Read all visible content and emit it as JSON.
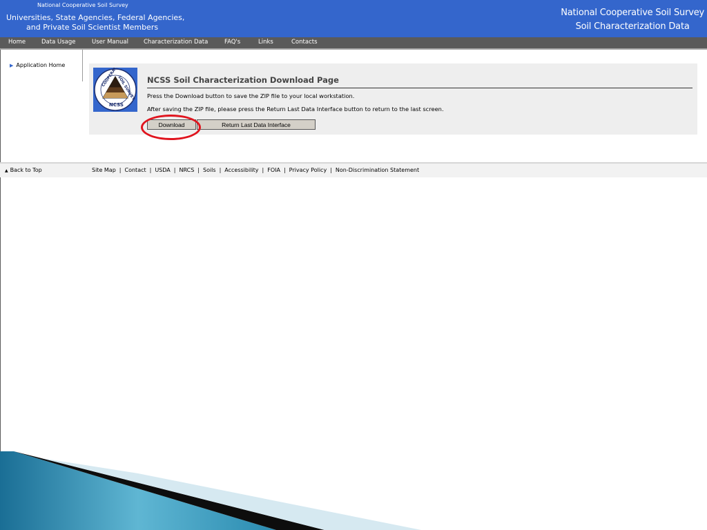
{
  "header": {
    "small_title": "National Cooperative Soil Survey",
    "left_line1": "Universities, State Agencies, Federal Agencies,",
    "left_line2": "and Private Soil Scientist Members",
    "right_line1": "National Cooperative Soil Survey",
    "right_line2": "Soil Characterization Data"
  },
  "nav": {
    "items": [
      {
        "label": "Home"
      },
      {
        "label": "Data Usage"
      },
      {
        "label": "User Manual"
      },
      {
        "label": "Characterization Data"
      },
      {
        "label": "FAQ's"
      },
      {
        "label": "Links"
      },
      {
        "label": "Contacts"
      }
    ]
  },
  "sidebar": {
    "items": [
      {
        "label": "Application Home"
      }
    ]
  },
  "logo": {
    "text_top": "COOPERATIVE",
    "text_right": "SOIL SURVEY",
    "text_bottom": "NCSS"
  },
  "main": {
    "title": "NCSS Soil Characterization Download Page",
    "line1": "Press the Download button to save the ZIP file to your local workstation.",
    "line2": "After saving the ZIP file, please press the Return Last Data Interface button to return to the last screen.",
    "download_label": "Download",
    "return_label": "Return Last Data Interface"
  },
  "footer": {
    "back_to_top": "Back to Top",
    "links": [
      {
        "label": "Site Map"
      },
      {
        "label": "Contact"
      },
      {
        "label": "USDA"
      },
      {
        "label": "NRCS"
      },
      {
        "label": "Soils"
      },
      {
        "label": "Accessibility"
      },
      {
        "label": "FOIA"
      },
      {
        "label": "Privacy Policy"
      },
      {
        "label": "Non-Discrimination Statement"
      }
    ]
  },
  "colors": {
    "header_blue": "#3466cc",
    "nav_gray": "#5a5a5a",
    "highlight_red": "#e0141e",
    "button_face": "#d4d0c8"
  }
}
